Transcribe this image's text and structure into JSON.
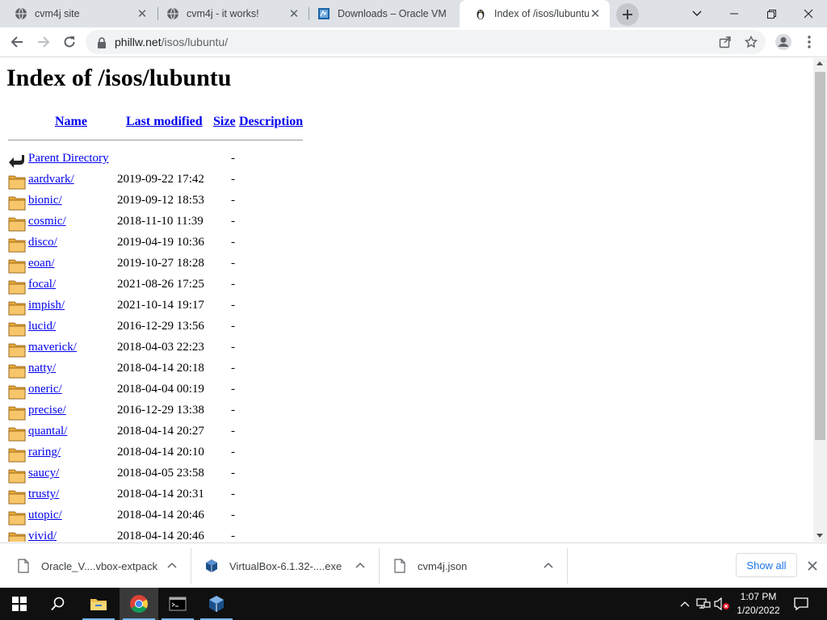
{
  "browser": {
    "tabs": [
      {
        "title": "cvm4j site",
        "icon": "globe-icon",
        "active": false
      },
      {
        "title": "cvm4j - it works!",
        "icon": "globe-icon",
        "active": false
      },
      {
        "title": "Downloads – Oracle VM",
        "icon": "virtualbox-icon",
        "active": false
      },
      {
        "title": "Index of /isos/lubuntu",
        "icon": "penguin-icon",
        "active": true
      }
    ],
    "url_host": "phillw.net",
    "url_path": "/isos/lubuntu/"
  },
  "page": {
    "title": "Index of /isos/lubuntu",
    "columns": {
      "name": "Name",
      "modified": "Last modified",
      "size": "Size",
      "description": "Description"
    },
    "entries": [
      {
        "name": "Parent Directory",
        "date": "",
        "size": "-",
        "icon": "back-arrow-icon"
      },
      {
        "name": "aardvark/",
        "date": "2019-09-22 17:42",
        "size": "-",
        "icon": "folder-icon"
      },
      {
        "name": "bionic/",
        "date": "2019-09-12 18:53",
        "size": "-",
        "icon": "folder-icon"
      },
      {
        "name": "cosmic/",
        "date": "2018-11-10 11:39",
        "size": "-",
        "icon": "folder-icon"
      },
      {
        "name": "disco/",
        "date": "2019-04-19 10:36",
        "size": "-",
        "icon": "folder-icon"
      },
      {
        "name": "eoan/",
        "date": "2019-10-27 18:28",
        "size": "-",
        "icon": "folder-icon"
      },
      {
        "name": "focal/",
        "date": "2021-08-26 17:25",
        "size": "-",
        "icon": "folder-icon"
      },
      {
        "name": "impish/",
        "date": "2021-10-14 19:17",
        "size": "-",
        "icon": "folder-icon"
      },
      {
        "name": "lucid/",
        "date": "2016-12-29 13:56",
        "size": "-",
        "icon": "folder-icon"
      },
      {
        "name": "maverick/",
        "date": "2018-04-03 22:23",
        "size": "-",
        "icon": "folder-icon"
      },
      {
        "name": "natty/",
        "date": "2018-04-14 20:18",
        "size": "-",
        "icon": "folder-icon"
      },
      {
        "name": "oneric/",
        "date": "2018-04-04 00:19",
        "size": "-",
        "icon": "folder-icon"
      },
      {
        "name": "precise/",
        "date": "2016-12-29 13:38",
        "size": "-",
        "icon": "folder-icon"
      },
      {
        "name": "quantal/",
        "date": "2018-04-14 20:27",
        "size": "-",
        "icon": "folder-icon"
      },
      {
        "name": "raring/",
        "date": "2018-04-14 20:10",
        "size": "-",
        "icon": "folder-icon"
      },
      {
        "name": "saucy/",
        "date": "2018-04-05 23:58",
        "size": "-",
        "icon": "folder-icon"
      },
      {
        "name": "trusty/",
        "date": "2018-04-14 20:31",
        "size": "-",
        "icon": "folder-icon"
      },
      {
        "name": "utopic/",
        "date": "2018-04-14 20:46",
        "size": "-",
        "icon": "folder-icon"
      },
      {
        "name": "vivid/",
        "date": "2018-04-14 20:46",
        "size": "-",
        "icon": "folder-icon"
      }
    ]
  },
  "downloads": {
    "items": [
      {
        "name": "Oracle_V....vbox-extpack",
        "icon": "file-icon"
      },
      {
        "name": "VirtualBox-6.1.32-....exe",
        "icon": "virtualbox-icon"
      },
      {
        "name": "cvm4j.json",
        "icon": "file-icon"
      }
    ],
    "show_all": "Show all"
  },
  "taskbar": {
    "time": "1:07 PM",
    "date": "1/20/2022"
  },
  "colors": {
    "link": "#0000ee",
    "tabstrip": "#dee1e6",
    "accent": "#1a73e8"
  }
}
